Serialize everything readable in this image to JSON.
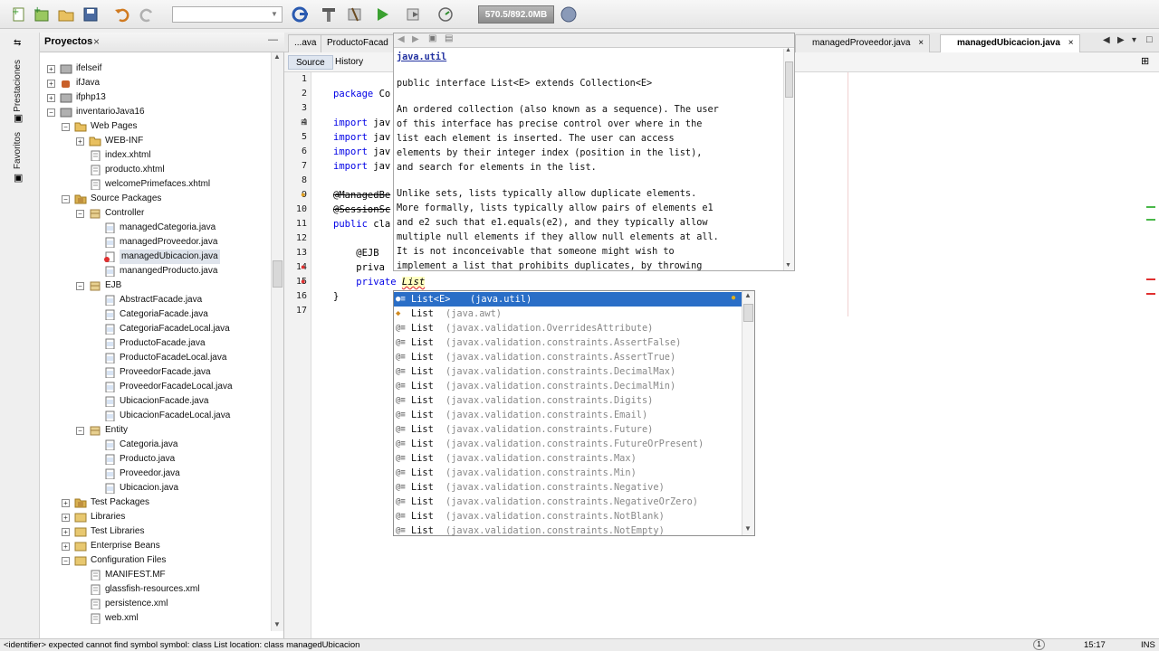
{
  "toolbar": {
    "memory_label": "570.5/892.0MB",
    "config_value": ""
  },
  "left_strip": {
    "labels": [
      "Prestaciones",
      "Favoritos"
    ]
  },
  "projects_panel": {
    "title": "Proyectos",
    "close_glyph": "×",
    "minimize_glyph": "—",
    "tree": [
      {
        "label": "ifelseif",
        "indent": 0,
        "toggle": "+",
        "icon": "project"
      },
      {
        "label": "ifJava",
        "indent": 0,
        "toggle": "+",
        "icon": "cup"
      },
      {
        "label": "ifphp13",
        "indent": 0,
        "toggle": "+",
        "icon": "project"
      },
      {
        "label": "inventarioJava16",
        "indent": 0,
        "toggle": "−",
        "icon": "project"
      },
      {
        "label": "Web Pages",
        "indent": 1,
        "toggle": "−",
        "icon": "folder"
      },
      {
        "label": "WEB-INF",
        "indent": 2,
        "toggle": "+",
        "icon": "folder"
      },
      {
        "label": "index.xhtml",
        "indent": 2,
        "toggle": "",
        "icon": "file"
      },
      {
        "label": "producto.xhtml",
        "indent": 2,
        "toggle": "",
        "icon": "file"
      },
      {
        "label": "welcomePrimefaces.xhtml",
        "indent": 2,
        "toggle": "",
        "icon": "file"
      },
      {
        "label": "Source Packages",
        "indent": 1,
        "toggle": "−",
        "icon": "pkgfolder"
      },
      {
        "label": "Controller",
        "indent": 2,
        "toggle": "−",
        "icon": "package"
      },
      {
        "label": "managedCategoria.java",
        "indent": 3,
        "toggle": "",
        "icon": "java"
      },
      {
        "label": "managedProveedor.java",
        "indent": 3,
        "toggle": "",
        "icon": "java"
      },
      {
        "label": "managedUbicacion.java",
        "indent": 3,
        "toggle": "",
        "icon": "javaerr",
        "selected": true
      },
      {
        "label": "manangedProducto.java",
        "indent": 3,
        "toggle": "",
        "icon": "java"
      },
      {
        "label": "EJB",
        "indent": 2,
        "toggle": "−",
        "icon": "package"
      },
      {
        "label": "AbstractFacade.java",
        "indent": 3,
        "toggle": "",
        "icon": "java"
      },
      {
        "label": "CategoriaFacade.java",
        "indent": 3,
        "toggle": "",
        "icon": "java"
      },
      {
        "label": "CategoriaFacadeLocal.java",
        "indent": 3,
        "toggle": "",
        "icon": "java"
      },
      {
        "label": "ProductoFacade.java",
        "indent": 3,
        "toggle": "",
        "icon": "java"
      },
      {
        "label": "ProductoFacadeLocal.java",
        "indent": 3,
        "toggle": "",
        "icon": "java"
      },
      {
        "label": "ProveedorFacade.java",
        "indent": 3,
        "toggle": "",
        "icon": "java"
      },
      {
        "label": "ProveedorFacadeLocal.java",
        "indent": 3,
        "toggle": "",
        "icon": "java"
      },
      {
        "label": "UbicacionFacade.java",
        "indent": 3,
        "toggle": "",
        "icon": "java"
      },
      {
        "label": "UbicacionFacadeLocal.java",
        "indent": 3,
        "toggle": "",
        "icon": "java"
      },
      {
        "label": "Entity",
        "indent": 2,
        "toggle": "−",
        "icon": "package"
      },
      {
        "label": "Categoria.java",
        "indent": 3,
        "toggle": "",
        "icon": "java"
      },
      {
        "label": "Producto.java",
        "indent": 3,
        "toggle": "",
        "icon": "java"
      },
      {
        "label": "Proveedor.java",
        "indent": 3,
        "toggle": "",
        "icon": "java"
      },
      {
        "label": "Ubicacion.java",
        "indent": 3,
        "toggle": "",
        "icon": "java"
      },
      {
        "label": "Test Packages",
        "indent": 1,
        "toggle": "+",
        "icon": "pkgfolder"
      },
      {
        "label": "Libraries",
        "indent": 1,
        "toggle": "+",
        "icon": "lib"
      },
      {
        "label": "Test Libraries",
        "indent": 1,
        "toggle": "+",
        "icon": "lib"
      },
      {
        "label": "Enterprise Beans",
        "indent": 1,
        "toggle": "+",
        "icon": "lib"
      },
      {
        "label": "Configuration Files",
        "indent": 1,
        "toggle": "−",
        "icon": "lib"
      },
      {
        "label": "MANIFEST.MF",
        "indent": 2,
        "toggle": "",
        "icon": "file"
      },
      {
        "label": "glassfish-resources.xml",
        "indent": 2,
        "toggle": "",
        "icon": "file"
      },
      {
        "label": "persistence.xml",
        "indent": 2,
        "toggle": "",
        "icon": "file"
      },
      {
        "label": "web.xml",
        "indent": 2,
        "toggle": "",
        "icon": "file"
      }
    ]
  },
  "editor": {
    "tabs": [
      "...ava",
      "ProductoFacad",
      "managedProveedor.java",
      "managedUbicacion.java"
    ],
    "active_tab": "managedUbicacion.java",
    "source_label": "Source",
    "history_label": "History",
    "lines": [
      {
        "n": "1",
        "text": ""
      },
      {
        "n": "2",
        "text": "package Co"
      },
      {
        "n": "3",
        "text": ""
      },
      {
        "n": "4",
        "text": "import jav"
      },
      {
        "n": "5",
        "text": "import jav"
      },
      {
        "n": "6",
        "text": "import jav"
      },
      {
        "n": "7",
        "text": "import jav"
      },
      {
        "n": "8",
        "text": ""
      },
      {
        "n": "9",
        "text": "@ManagedBe"
      },
      {
        "n": "10",
        "text": "@SessionSc"
      },
      {
        "n": "11",
        "text": "public cla"
      },
      {
        "n": "12",
        "text": ""
      },
      {
        "n": "13",
        "text": "    @EJB"
      },
      {
        "n": "14",
        "text": "    priva"
      },
      {
        "n": "15",
        "text": "    private List"
      },
      {
        "n": "16",
        "text": "}"
      },
      {
        "n": "17",
        "text": ""
      }
    ]
  },
  "javadoc": {
    "package": "java.util",
    "signature": "public interface List<E> extends Collection<E>",
    "paragraph1": [
      "An ordered collection (also known as a sequence). The user",
      "of this interface has precise control over where in the",
      "list each element is inserted. The user can access",
      "elements by their integer index (position in the list),",
      "and search for elements in the list."
    ],
    "paragraph2": [
      "Unlike sets, lists typically allow duplicate elements.",
      "More formally, lists typically allow pairs of elements e1",
      "and e2 such that e1.equals(e2), and they typically allow",
      "multiple null elements if they allow null elements at all.",
      "It is not inconceivable that someone might wish to",
      "implement a list that prohibits duplicates, by throwing"
    ]
  },
  "completion": {
    "items": [
      {
        "name": "List<E>",
        "pkg": "(java.util)",
        "icon": "interface"
      },
      {
        "name": "List",
        "pkg": "(java.awt)",
        "icon": "class"
      },
      {
        "name": "List",
        "pkg": "(javax.validation.OverridesAttribute)",
        "icon": "annotation"
      },
      {
        "name": "List",
        "pkg": "(javax.validation.constraints.AssertFalse)",
        "icon": "annotation"
      },
      {
        "name": "List",
        "pkg": "(javax.validation.constraints.AssertTrue)",
        "icon": "annotation"
      },
      {
        "name": "List",
        "pkg": "(javax.validation.constraints.DecimalMax)",
        "icon": "annotation"
      },
      {
        "name": "List",
        "pkg": "(javax.validation.constraints.DecimalMin)",
        "icon": "annotation"
      },
      {
        "name": "List",
        "pkg": "(javax.validation.constraints.Digits)",
        "icon": "annotation"
      },
      {
        "name": "List",
        "pkg": "(javax.validation.constraints.Email)",
        "icon": "annotation"
      },
      {
        "name": "List",
        "pkg": "(javax.validation.constraints.Future)",
        "icon": "annotation"
      },
      {
        "name": "List",
        "pkg": "(javax.validation.constraints.FutureOrPresent)",
        "icon": "annotation"
      },
      {
        "name": "List",
        "pkg": "(javax.validation.constraints.Max)",
        "icon": "annotation"
      },
      {
        "name": "List",
        "pkg": "(javax.validation.constraints.Min)",
        "icon": "annotation"
      },
      {
        "name": "List",
        "pkg": "(javax.validation.constraints.Negative)",
        "icon": "annotation"
      },
      {
        "name": "List",
        "pkg": "(javax.validation.constraints.NegativeOrZero)",
        "icon": "annotation"
      },
      {
        "name": "List",
        "pkg": "(javax.validation.constraints.NotBlank)",
        "icon": "annotation"
      },
      {
        "name": "List",
        "pkg": "(javax.validation.constraints.NotEmpty)",
        "icon": "annotation"
      }
    ],
    "selected_index": 0
  },
  "statusbar": {
    "message": "<identifier> expected  cannot find symbol  symbol:  class List  location: class managedUbicacion",
    "notifications": "1",
    "position": "15:17",
    "mode": "INS"
  },
  "colors": {
    "selection": "#2a6ec7",
    "error": "#e03030",
    "keyword": "#0000e6"
  }
}
